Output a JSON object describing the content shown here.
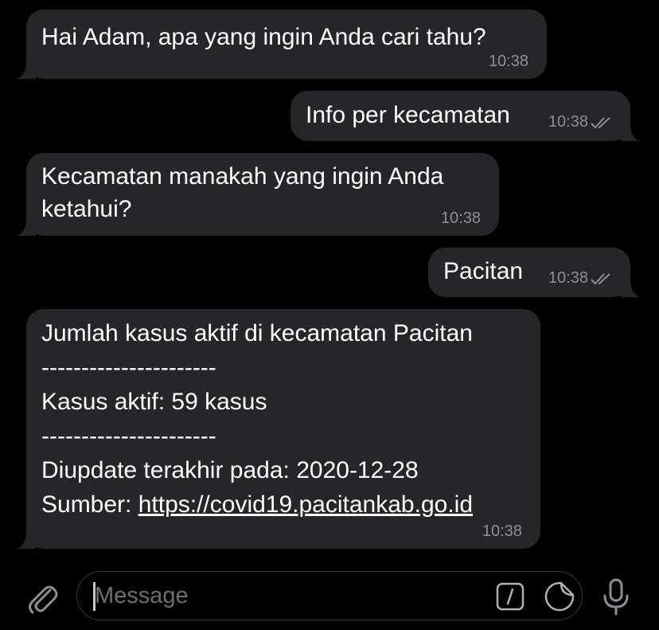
{
  "messages": [
    {
      "text": "Hai Adam, apa yang ingin Anda cari tahu?",
      "time": "10:38"
    },
    {
      "text": "Info per kecamatan",
      "time": "10:38"
    },
    {
      "line1": "Kecamatan manakah yang ingin Anda",
      "line2": "ketahui?",
      "time": "10:38"
    },
    {
      "text": "Pacitan",
      "time": "10:38"
    },
    {
      "line1": "Jumlah kasus aktif di kecamatan Pacitan",
      "line2": "----------------------",
      "line3": "Kasus aktif: 59 kasus",
      "line4": "----------------------",
      "line5": "Diupdate terakhir pada: 2020-12-28",
      "line6_prefix": "Sumber: ",
      "line6_link": "https://covid19.pacitankab.go.id",
      "time": "10:38"
    }
  ],
  "input": {
    "placeholder": "Message"
  },
  "icons": {
    "attach": "paperclip-icon",
    "commands": "slash-command-icon",
    "sticker": "sticker-icon",
    "mic": "microphone-icon",
    "read": "double-check-icon"
  },
  "colors": {
    "background": "#000000",
    "bubble": "#262628",
    "time": "#8e8e93",
    "text": "#ffffff"
  }
}
